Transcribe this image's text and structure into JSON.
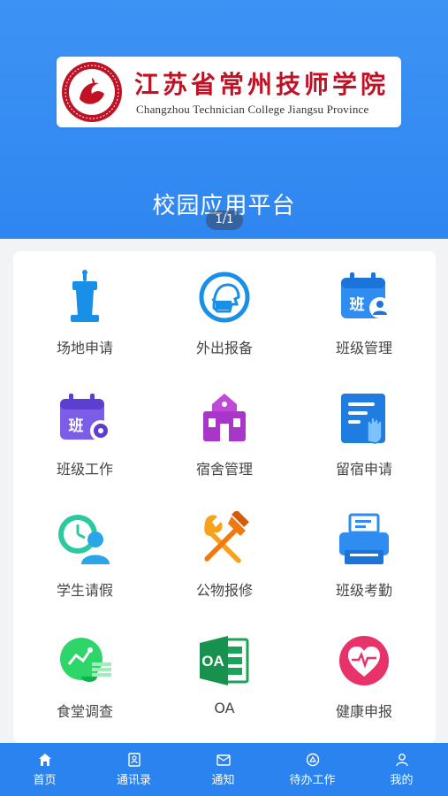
{
  "banner": {
    "college_cn": "江苏省常州技师学院",
    "college_en": "Changzhou Technician College Jiangsu Province",
    "platform_title": "校园应用平台",
    "pager": "1/1"
  },
  "apps": [
    {
      "label": "场地申请",
      "icon": "podium-icon"
    },
    {
      "label": "外出报备",
      "icon": "masked-face-icon"
    },
    {
      "label": "班级管理",
      "icon": "class-calendar-user-icon"
    },
    {
      "label": "班级工作",
      "icon": "class-calendar-gear-icon"
    },
    {
      "label": "宿舍管理",
      "icon": "dormitory-icon"
    },
    {
      "label": "留宿申请",
      "icon": "document-hand-icon"
    },
    {
      "label": "学生请假",
      "icon": "clock-person-icon"
    },
    {
      "label": "公物报修",
      "icon": "wrench-hammer-icon"
    },
    {
      "label": "班级考勤",
      "icon": "printer-icon"
    },
    {
      "label": "食堂调查",
      "icon": "canteen-survey-icon"
    },
    {
      "label": "OA",
      "icon": "oa-icon"
    },
    {
      "label": "健康申报",
      "icon": "heart-pulse-icon"
    }
  ],
  "icon_text": {
    "ban": "班",
    "oa": "OA"
  },
  "tabs": [
    {
      "label": "首页",
      "icon": "home-icon"
    },
    {
      "label": "通讯录",
      "icon": "contacts-icon"
    },
    {
      "label": "通知",
      "icon": "mail-icon"
    },
    {
      "label": "待办工作",
      "icon": "todo-icon"
    },
    {
      "label": "我的",
      "icon": "user-icon"
    }
  ],
  "colors": {
    "banner": "#3d93f4",
    "tabbar": "#2a83ee",
    "seal_red": "#c01224"
  }
}
